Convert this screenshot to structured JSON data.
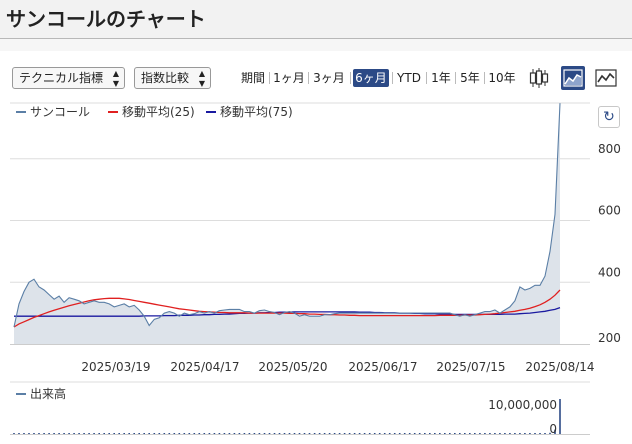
{
  "page": {
    "title": "サンコールのチャート"
  },
  "toolbar": {
    "technical_select": "テクニカル指標",
    "index_select": "指数比較",
    "ranges": [
      "期間",
      "1ヶ月",
      "3ヶ月",
      "6ヶ月",
      "YTD",
      "1年",
      "5年",
      "10年"
    ],
    "active_range": "6ヶ月",
    "chart_types": [
      {
        "name": "candlestick-icon",
        "active": false
      },
      {
        "name": "area-chart-icon",
        "active": true
      },
      {
        "name": "line-chart-icon",
        "active": false
      }
    ]
  },
  "colors": {
    "accent": "#2c4a86",
    "price_line": "#5b7fa6",
    "price_fill": "#dde3ea",
    "ma25": "#e02020",
    "ma75": "#1a1aa0",
    "volume": "#2c4a86"
  },
  "chart_data": [
    {
      "type": "area",
      "legend_position": "top-left",
      "series": [
        {
          "name": "サンコール",
          "color": "#5b7fa6",
          "values": [
            255,
            330,
            370,
            400,
            410,
            385,
            375,
            360,
            345,
            355,
            335,
            350,
            345,
            340,
            330,
            335,
            340,
            335,
            335,
            330,
            320,
            325,
            330,
            320,
            325,
            310,
            290,
            260,
            280,
            285,
            300,
            305,
            300,
            290,
            300,
            295,
            298,
            305,
            300,
            305,
            300,
            308,
            310,
            312,
            312,
            312,
            305,
            305,
            300,
            308,
            310,
            305,
            302,
            295,
            302,
            305,
            300,
            290,
            295,
            290,
            290,
            290,
            295,
            295,
            298,
            300,
            300,
            300,
            300,
            300,
            300,
            300,
            300,
            300,
            300,
            300,
            300,
            300,
            300,
            300,
            300,
            300,
            300,
            300,
            300,
            300,
            300,
            300,
            295,
            290,
            295,
            290,
            295,
            300,
            305,
            305,
            310,
            300,
            310,
            320,
            340,
            385,
            375,
            380,
            390,
            390,
            420,
            500,
            620,
            980
          ]
        },
        {
          "name": "移動平均(25)",
          "color": "#e02020",
          "values": [
            255,
            265,
            272,
            279,
            286,
            292,
            298,
            304,
            309,
            314,
            319,
            324,
            328,
            332,
            336,
            340,
            343,
            345,
            347,
            348,
            348,
            348,
            346,
            344,
            341,
            338,
            335,
            332,
            329,
            326,
            323,
            320,
            317,
            314,
            312,
            310,
            308,
            306,
            305,
            304,
            303,
            302,
            302,
            301,
            301,
            301,
            301,
            300,
            300,
            300,
            300,
            300,
            300,
            300,
            300,
            299,
            299,
            298,
            298,
            297,
            297,
            296,
            296,
            295,
            295,
            294,
            294,
            293,
            293,
            292,
            292,
            292,
            292,
            292,
            292,
            292,
            292,
            292,
            292,
            292,
            292,
            292,
            292,
            292,
            292,
            293,
            293,
            293,
            293,
            293,
            294,
            294,
            294,
            295,
            296,
            297,
            298,
            300,
            302,
            304,
            306,
            309,
            312,
            316,
            321,
            327,
            335,
            345,
            358,
            375
          ]
        },
        {
          "name": "移動平均(75)",
          "color": "#1a1aa0",
          "values": [
            290,
            290,
            290,
            290,
            290,
            290,
            290,
            290,
            290,
            290,
            290,
            290,
            290,
            290,
            290,
            290,
            290,
            290,
            290,
            290,
            290,
            290,
            290,
            290,
            290,
            290,
            291,
            291,
            291,
            291,
            292,
            292,
            292,
            293,
            293,
            293,
            294,
            294,
            295,
            295,
            296,
            296,
            297,
            297,
            298,
            299,
            299,
            300,
            300,
            301,
            301,
            302,
            302,
            303,
            303,
            303,
            304,
            304,
            304,
            304,
            304,
            304,
            304,
            304,
            304,
            304,
            304,
            304,
            304,
            303,
            303,
            303,
            302,
            302,
            301,
            301,
            301,
            300,
            300,
            300,
            299,
            299,
            298,
            298,
            298,
            297,
            297,
            297,
            296,
            296,
            296,
            296,
            296,
            296,
            296,
            296,
            296,
            296,
            297,
            297,
            297,
            298,
            299,
            300,
            302,
            304,
            306,
            309,
            312,
            318
          ]
        }
      ],
      "x_ticks": [
        "2025/03/19",
        "2025/04/17",
        "2025/05/20",
        "2025/06/17",
        "2025/07/15",
        "2025/08/14"
      ],
      "y_ticks": [
        200,
        400,
        600,
        800
      ],
      "ylim": [
        200,
        1000
      ],
      "grid": true
    },
    {
      "type": "bar",
      "legend_position": "top-left",
      "series": [
        {
          "name": "出来高",
          "color": "#2c4a86",
          "values": [
            80000,
            50000,
            150000,
            60000,
            40000,
            30000,
            40000,
            50000,
            30000,
            20000,
            40000,
            30000,
            20000,
            20000,
            30000,
            20000,
            20000,
            15000,
            20000,
            30000,
            20000,
            15000,
            20000,
            25000,
            20000,
            30000,
            40000,
            25000,
            20000,
            20000,
            30000,
            20000,
            20000,
            15000,
            20000,
            15000,
            20000,
            15000,
            20000,
            15000,
            20000,
            15000,
            10000,
            15000,
            20000,
            15000,
            10000,
            15000,
            20000,
            10000,
            15000,
            10000,
            20000,
            15000,
            10000,
            15000,
            10000,
            10000,
            15000,
            10000,
            15000,
            10000,
            15000,
            10000,
            15000,
            10000,
            15000,
            10000,
            15000,
            10000,
            15000,
            10000,
            15000,
            10000,
            15000,
            10000,
            15000,
            10000,
            15000,
            10000,
            15000,
            10000,
            15000,
            10000,
            15000,
            10000,
            15000,
            10000,
            15000,
            10000,
            15000,
            10000,
            15000,
            10000,
            20000,
            20000,
            30000,
            20000,
            30000,
            40000,
            60000,
            120000,
            80000,
            60000,
            80000,
            100000,
            150000,
            400000,
            1500000,
            12000000
          ]
        }
      ],
      "y_ticks": [
        0,
        10000000
      ],
      "y_tick_labels": [
        "0",
        "10,000,000"
      ],
      "ylim": [
        0,
        12000000
      ]
    }
  ]
}
